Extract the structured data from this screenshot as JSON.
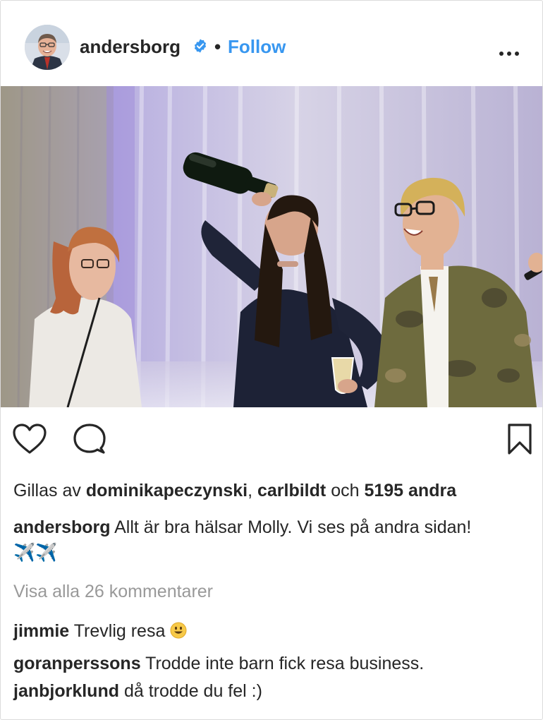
{
  "post": {
    "username": "andersborg",
    "follow_separator": "•",
    "follow_label": "Follow",
    "verified_icon": "verified-badge-icon",
    "more_icon": "more-options-icon",
    "photo_alt": "Party photo",
    "likes": {
      "prefix": "Gillas av",
      "user1": "dominikapeczynski",
      "sep": ",",
      "user2": "carlbildt",
      "connector": "och",
      "others": "5195 andra"
    },
    "caption": {
      "username": "andersborg",
      "text": "Allt är bra hälsar Molly. Vi ses på andra sidan!",
      "emoji": "✈️✈️"
    },
    "view_all_comments": "Visa alla 26 kommentarer",
    "comments": [
      {
        "username": "jimmie",
        "text": "Trevlig resa"
      },
      {
        "username": "goranperssons",
        "text": "Trodde inte barn fick resa business."
      },
      {
        "username": "janbjorklund",
        "text": "då trodde du fel :)"
      }
    ],
    "colors": {
      "link": "#3897f0",
      "text": "#262626",
      "muted": "#999999",
      "border": "#dbdbdb"
    }
  }
}
